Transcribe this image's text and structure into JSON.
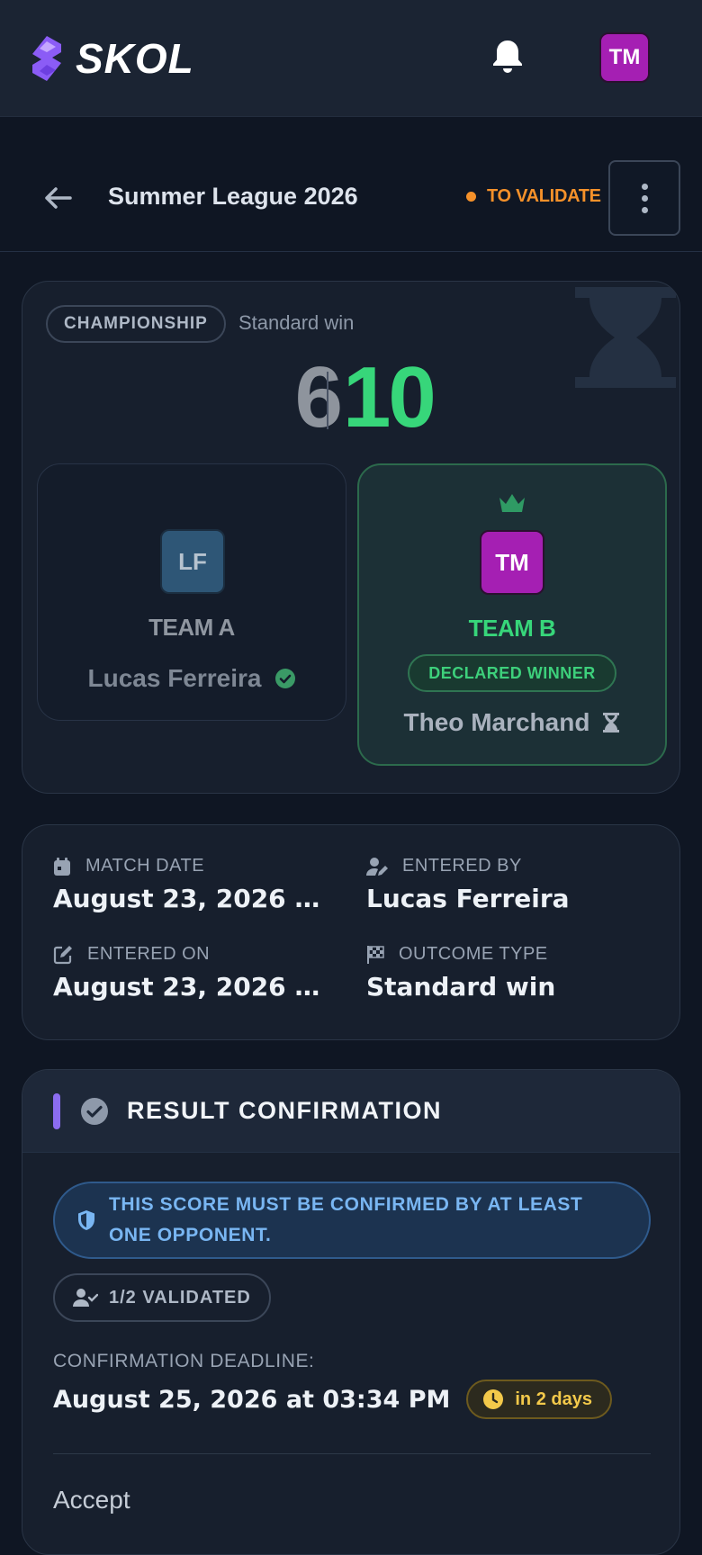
{
  "app": {
    "brand": "SKOL",
    "user_initials": "TM"
  },
  "header": {
    "title": "Summer League 2026",
    "status": "TO VALIDATE"
  },
  "match": {
    "category": "CHAMPIONSHIP",
    "outcome": "Standard win",
    "score_a": "6",
    "score_b": "10",
    "team_a": {
      "name": "TEAM A",
      "initials": "LF",
      "player": "Lucas Ferreira"
    },
    "team_b": {
      "name": "TEAM B",
      "initials": "TM",
      "player": "Theo Marchand",
      "badge": "DECLARED WINNER"
    }
  },
  "details": {
    "match_date_label": "MATCH DATE",
    "match_date": "August 23, 2026 at 0...",
    "entered_by_label": "ENTERED BY",
    "entered_by": "Lucas Ferreira",
    "entered_on_label": "ENTERED ON",
    "entered_on": "August 23, 2026 at 0...",
    "outcome_type_label": "OUTCOME TYPE",
    "outcome_type": "Standard win"
  },
  "confirmation": {
    "title": "RESULT CONFIRMATION",
    "info": "THIS SCORE MUST BE CONFIRMED BY AT LEAST ONE OPPONENT.",
    "validated": "1/2 VALIDATED",
    "deadline_label": "CONFIRMATION DEADLINE:",
    "deadline": "August 25, 2026 at 03:34 PM",
    "deadline_relative": "in 2 days",
    "accept_label": "Accept"
  },
  "colors": {
    "accent": "#8b6cf0",
    "status_orange": "#f5912a",
    "winner_green": "#37d67a",
    "info_blue": "#79b6f2",
    "deadline_yellow": "#f3c94a"
  },
  "icons": {
    "logo": "skol-logo-icon",
    "notifications": "bell-icon",
    "back": "arrow-left-icon",
    "menu": "more-vertical-icon",
    "pending": "hourglass-icon",
    "winner": "crown-icon",
    "verified": "check-circle-icon",
    "date": "calendar-icon",
    "entered_by": "user-edit-icon",
    "entered_on": "edit-icon",
    "outcome": "checkered-flag-icon",
    "confirmation": "check-circle-icon",
    "info": "shield-icon",
    "validated": "user-check-icon",
    "deadline": "clock-icon"
  }
}
